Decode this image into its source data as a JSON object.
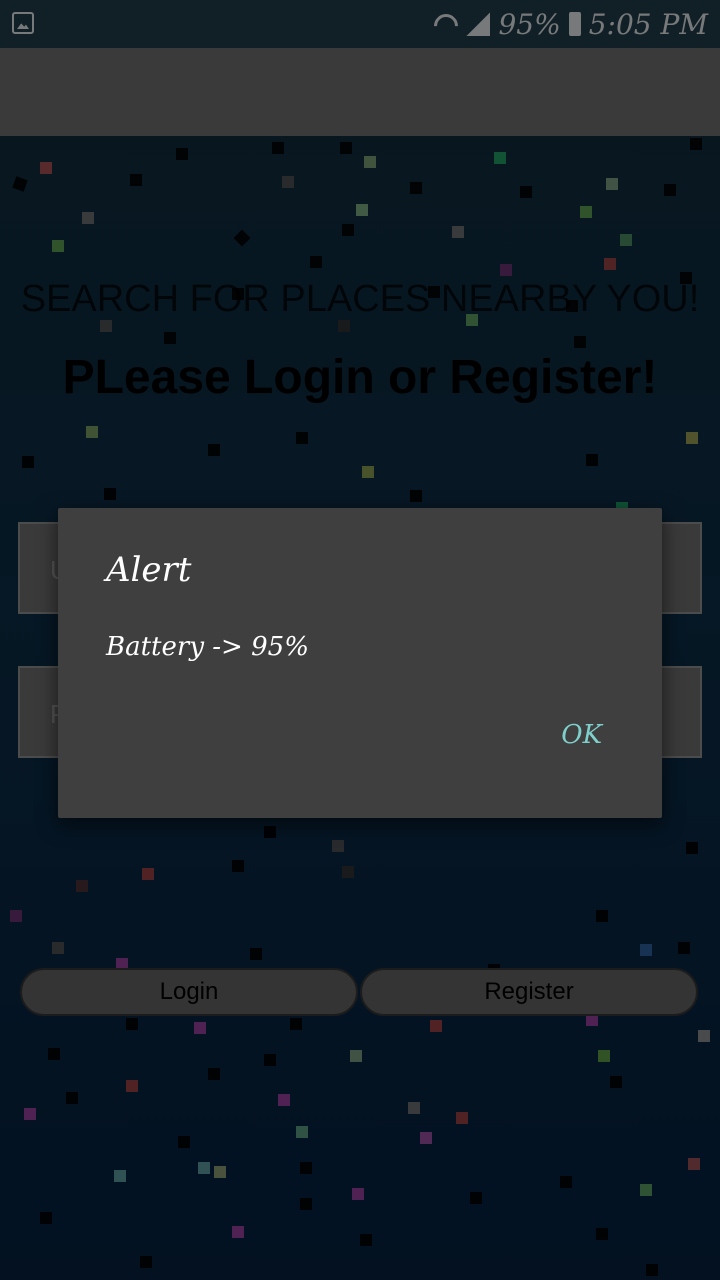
{
  "status_bar": {
    "battery_text": "95%",
    "time": "5:05 PM",
    "icons": [
      "image-icon",
      "wifi-icon",
      "signal-icon",
      "battery-icon"
    ]
  },
  "main": {
    "subtitle": "SEARCH FOR PLACES NEARBY YOU!",
    "title": "PLease Login or Register!",
    "fields": {
      "username_placeholder": "U",
      "password_placeholder": "P"
    },
    "buttons": {
      "login": "Login",
      "register": "Register"
    }
  },
  "dialog": {
    "title": "Alert",
    "message": "Battery -> 95%",
    "ok_label": "OK",
    "accent_color": "#7fd0cc"
  }
}
